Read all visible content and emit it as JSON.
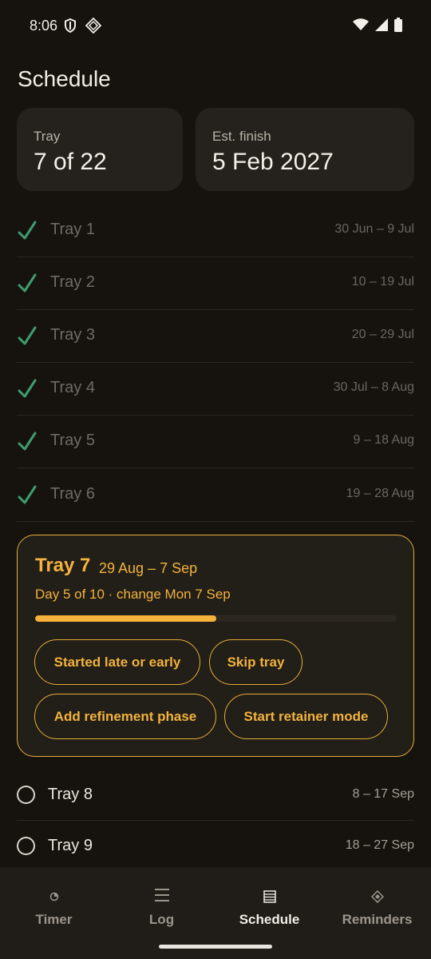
{
  "status_bar": {
    "time": "8:06"
  },
  "page": {
    "title": "Schedule"
  },
  "stats": {
    "tray_label": "Tray",
    "tray_value": "7 of 22",
    "finish_label": "Est. finish",
    "finish_value": "5 Feb 2027"
  },
  "completed_trays": [
    {
      "name": "Tray 1",
      "dates": "30 Jun – 9 Jul"
    },
    {
      "name": "Tray 2",
      "dates": "10 – 19 Jul"
    },
    {
      "name": "Tray 3",
      "dates": "20 – 29 Jul"
    },
    {
      "name": "Tray 4",
      "dates": "30 Jul – 8 Aug"
    },
    {
      "name": "Tray 5",
      "dates": "9 – 18 Aug"
    },
    {
      "name": "Tray 6",
      "dates": "19 – 28 Aug"
    }
  ],
  "current_tray": {
    "name": "Tray 7",
    "dates": "29 Aug – 7 Sep",
    "day_info": "Day 5 of 10 · change Mon 7 Sep",
    "progress": 0.5,
    "actions": {
      "started_late": "Started late or early",
      "skip": "Skip tray",
      "refinement": "Add refinement phase",
      "retainer": "Start retainer mode"
    }
  },
  "upcoming_trays": [
    {
      "name": "Tray 8",
      "dates": "8 – 17 Sep"
    },
    {
      "name": "Tray 9",
      "dates": "18 – 27 Sep"
    }
  ],
  "nav": {
    "items": [
      {
        "label": "Timer",
        "icon": "timer-icon"
      },
      {
        "label": "Log",
        "icon": "list-icon"
      },
      {
        "label": "Schedule",
        "icon": "schedule-icon",
        "active": true
      },
      {
        "label": "Reminders",
        "icon": "reminders-icon"
      }
    ]
  },
  "colors": {
    "accent": "#f3b33c",
    "check": "#3e9d6e",
    "background": "#16130f"
  }
}
